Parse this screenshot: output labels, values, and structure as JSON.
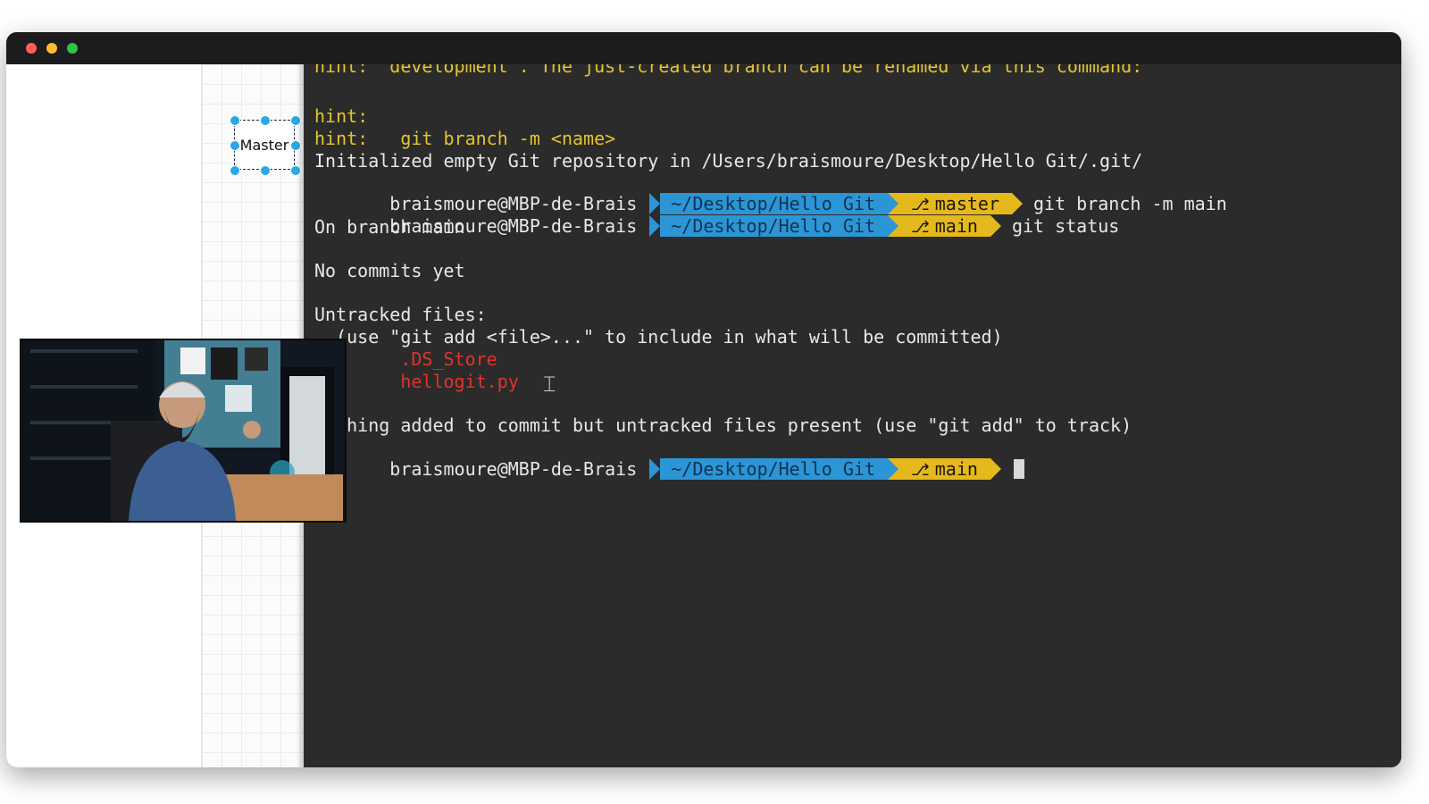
{
  "window": {
    "controls": [
      "close",
      "minimize",
      "zoom"
    ],
    "accent_colors": {
      "close": "#ff5f57",
      "minimize": "#febc2e",
      "zoom": "#28c840"
    }
  },
  "canvas": {
    "node_label": "Master"
  },
  "terminal": {
    "top_partial": "hint:  development'. The just-created branch can be renamed via this command:",
    "hint1": "hint:",
    "hint2": "hint:   git branch -m <name>",
    "init_line": "Initialized empty Git repository in /Users/braismoure/Desktop/Hello Git/.git/",
    "prompt1": {
      "user": " braismoure@MBP-de-Brais",
      "path": "~/Desktop/Hello Git",
      "branch": "master",
      "command": "git branch -m main"
    },
    "prompt2": {
      "user": " braismoure@MBP-de-Brais",
      "path": "~/Desktop/Hello Git",
      "branch": "main",
      "command": "git status"
    },
    "on_branch": "On branch main",
    "no_commits": "No commits yet",
    "untracked_header": "Untracked files:",
    "untracked_hint": "  (use \"git add <file>...\" to include in what will be committed)",
    "file1": "        .DS_Store",
    "file2": "        hellogit.py",
    "nothing_added": "nothing added to commit but untracked files present (use \"git add\" to track)",
    "prompt3": {
      "user": " braismoure@MBP-de-Brais",
      "path": "~/Desktop/Hello Git",
      "branch": "main"
    },
    "colors": {
      "hint": "#e3c52f",
      "path_segment": "#2c95d6",
      "branch_segment": "#e5b81d",
      "untracked": "#e0332d"
    }
  }
}
